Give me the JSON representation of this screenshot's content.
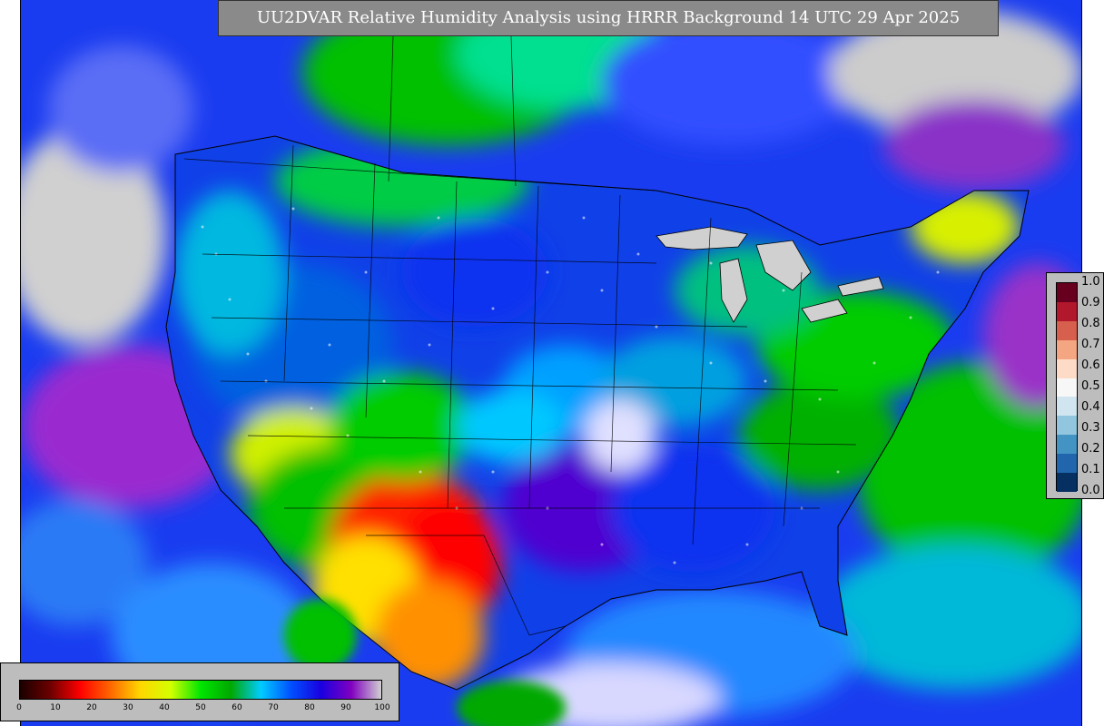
{
  "title": "UU2DVAR Relative Humidity Analysis using HRRR Background 14 UTC 29 Apr 2025",
  "colorbar": {
    "ticks": [
      "0",
      "10",
      "20",
      "30",
      "40",
      "50",
      "60",
      "70",
      "80",
      "90",
      "100"
    ],
    "colors": [
      "#1a0000",
      "#6b0000",
      "#ff0000",
      "#ff6600",
      "#ffd700",
      "#d4ff00",
      "#00e600",
      "#00a800",
      "#00ccff",
      "#0050ff",
      "#1a00e0",
      "#8000c0",
      "#d0d0d0"
    ]
  },
  "legend": {
    "ticks": [
      "1.0",
      "0.9",
      "0.8",
      "0.7",
      "0.6",
      "0.5",
      "0.4",
      "0.3",
      "0.2",
      "0.1",
      "0.0"
    ],
    "colors": [
      "#67001f",
      "#b2182b",
      "#d6604d",
      "#f4a582",
      "#fddbc7",
      "#f7f7f7",
      "#d1e5f0",
      "#92c5de",
      "#4393c3",
      "#2166ac",
      "#053061"
    ]
  }
}
